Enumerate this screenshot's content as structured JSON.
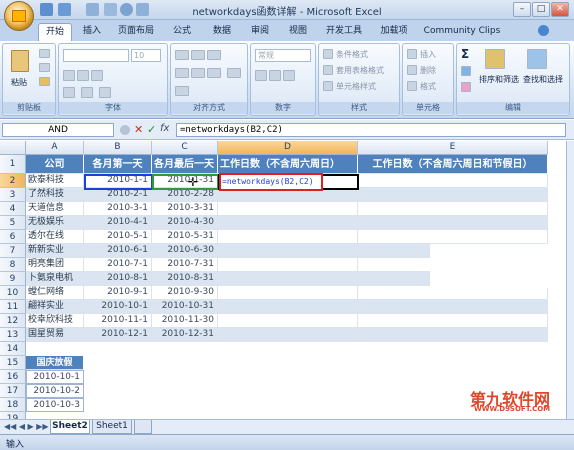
{
  "window": {
    "title": "networkdays函数详解 - Microsoft Excel"
  },
  "tabs": [
    "开始",
    "插入",
    "页面布局",
    "公式",
    "数据",
    "审阅",
    "视图",
    "开发工具",
    "加载项",
    "Community Clips"
  ],
  "ribbon": {
    "paste": "粘贴",
    "clipboard": "剪贴板",
    "font_size": "10",
    "font": "字体",
    "align": "对齐方式",
    "number_format": "常规",
    "number": "数字",
    "cond_format": "条件格式",
    "table_format": "套用表格格式",
    "cell_style": "单元格样式",
    "style": "样式",
    "insert": "插入",
    "delete": "删除",
    "format": "格式",
    "cells": "单元格",
    "sort": "排序和筛选",
    "find": "查找和选择",
    "edit": "编辑"
  },
  "formula_bar": {
    "name_box": "AND",
    "formula": "=networkdays(B2,C2)"
  },
  "columns": [
    "A",
    "B",
    "C",
    "D",
    "E"
  ],
  "rows": [
    "1",
    "2",
    "3",
    "4",
    "5",
    "6",
    "7",
    "8",
    "9",
    "10",
    "11",
    "12",
    "13",
    "14",
    "15",
    "16",
    "17",
    "18",
    "19"
  ],
  "headers": [
    "公司",
    "各月第一天",
    "各月最后一天",
    "工作日数（不含周六周日）",
    "工作日数（不含周六周日和节假日）"
  ],
  "data": [
    [
      "欧泰科技",
      "2010-1-1",
      "2010-1-31"
    ],
    [
      "了然科技",
      "2010-2-1",
      "2010-2-28"
    ],
    [
      "天道信息",
      "2010-3-1",
      "2010-3-31"
    ],
    [
      "无极娱乐",
      "2010-4-1",
      "2010-4-30"
    ],
    [
      "透尔在线",
      "2010-5-1",
      "2010-5-31"
    ],
    [
      "新新实业",
      "2010-6-1",
      "2010-6-30"
    ],
    [
      "明亮集团",
      "2010-7-1",
      "2010-7-31"
    ],
    [
      "卜氨泉电机",
      "2010-8-1",
      "2010-8-31"
    ],
    [
      "螳仁网络",
      "2010-9-1",
      "2010-9-30"
    ],
    [
      "翩祥实业",
      "2010-10-1",
      "2010-10-31"
    ],
    [
      "校幸欣科技",
      "2010-11-1",
      "2010-11-30"
    ],
    [
      "国星贸易",
      "2010-12-1",
      "2010-12-31"
    ]
  ],
  "edit_cell_text": "=networkdays(B2,C2)",
  "holiday": {
    "title": "国庆放假",
    "dates": [
      "2010-10-1",
      "2010-10-2",
      "2010-10-3"
    ]
  },
  "sheets": [
    "Sheet2",
    "Sheet1"
  ],
  "status": {
    "mode": "输入"
  },
  "watermark": {
    "brand": "第九软件网",
    "url": "WWW.D9SOFT.COM"
  },
  "colors": {
    "header_fill": "#4f81bd",
    "band_fill": "#dbe5f1",
    "ref_b2": "#1f3fd6",
    "ref_c2": "#2f9a3a",
    "formula_box": "#e02020"
  }
}
